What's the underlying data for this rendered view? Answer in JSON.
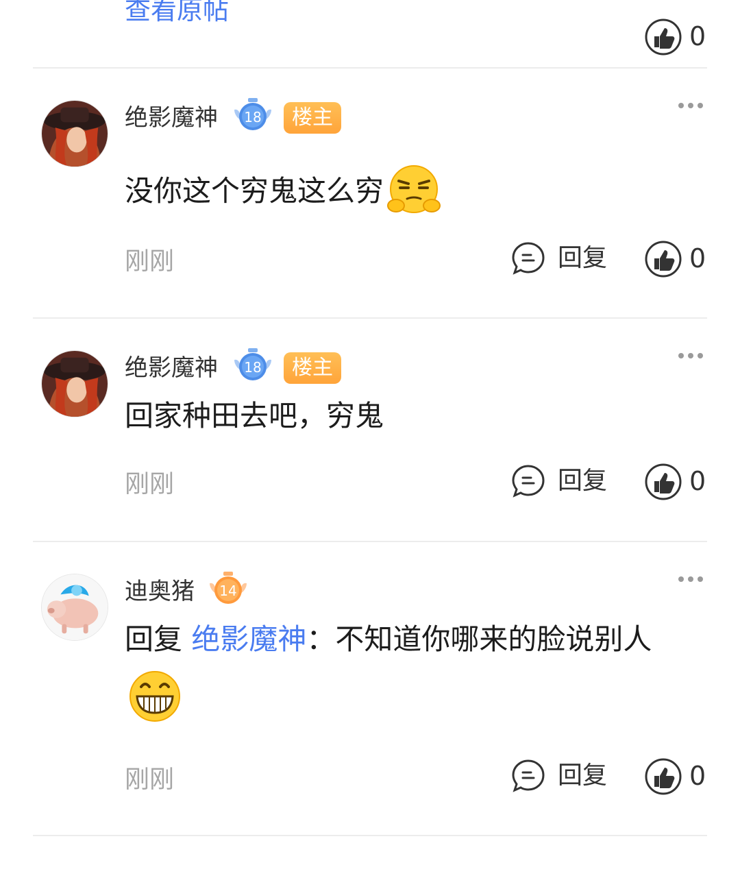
{
  "top": {
    "view_original_label": "查看原帖",
    "like_count": "0"
  },
  "comments": [
    {
      "username": "绝影魔神",
      "level": "18",
      "owner_badge": "楼主",
      "text": "没你这个穷鬼这么穷",
      "emoji": "smug-emoji",
      "timestamp": "刚刚",
      "reply_label": "回复",
      "like_count": "0"
    },
    {
      "username": "绝影魔神",
      "level": "18",
      "owner_badge": "楼主",
      "text": "回家种田去吧，穷鬼",
      "timestamp": "刚刚",
      "reply_label": "回复",
      "like_count": "0"
    },
    {
      "username": "迪奥猪",
      "level": "14",
      "reply_prefix": "回复",
      "mention": "绝影魔神",
      "text_after_mention": "：不知道你哪来的脸说别人",
      "emoji": "grin-emoji",
      "timestamp": "刚刚",
      "reply_label": "回复",
      "like_count": "0"
    }
  ],
  "colors": {
    "link": "#4a7cf0",
    "owner_badge": "#ffad45",
    "level_badge_blue": "#4d8de8",
    "level_badge_orange": "#ff9a3c",
    "muted": "#a6a6a6"
  }
}
